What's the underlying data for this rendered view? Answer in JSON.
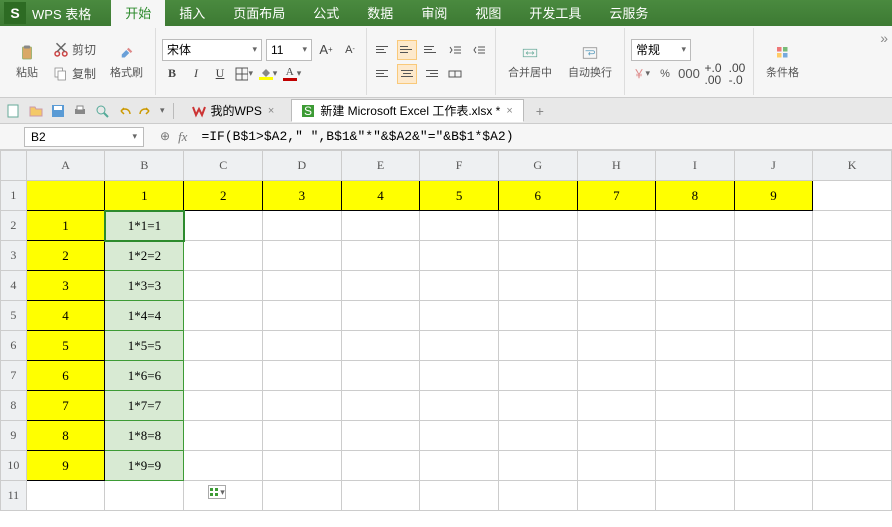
{
  "app": {
    "logo_letter": "S",
    "title": "WPS 表格"
  },
  "menu": {
    "tabs": [
      "开始",
      "插入",
      "页面布局",
      "公式",
      "数据",
      "审阅",
      "视图",
      "开发工具",
      "云服务"
    ],
    "active": 0
  },
  "ribbon": {
    "paste": "粘贴",
    "cut": "剪切",
    "copy": "复制",
    "format_painter": "格式刷",
    "font_name": "宋体",
    "font_size": "11",
    "merge_center": "合并居中",
    "wrap_text": "自动换行",
    "number_format": "常规",
    "cond_format": "条件格"
  },
  "qat": {
    "doc1": "我的WPS",
    "doc2": "新建 Microsoft Excel 工作表.xlsx *"
  },
  "formula_bar": {
    "cell_ref": "B2",
    "formula": "=IF(B$1>$A2,\" \",B$1&\"*\"&$A2&\"=\"&B$1*$A2)"
  },
  "sheet": {
    "col_headers": [
      "A",
      "B",
      "C",
      "D",
      "E",
      "F",
      "G",
      "H",
      "I",
      "J",
      "K"
    ],
    "row_headers": [
      "1",
      "2",
      "3",
      "4",
      "5",
      "6",
      "7",
      "8",
      "9",
      "10",
      "11"
    ],
    "row1": [
      "",
      "1",
      "2",
      "3",
      "4",
      "5",
      "6",
      "7",
      "8",
      "9"
    ],
    "colA": [
      "1",
      "2",
      "3",
      "4",
      "5",
      "6",
      "7",
      "8",
      "9"
    ],
    "colB": [
      "1*1=1",
      "1*2=2",
      "1*3=3",
      "1*4=4",
      "1*5=5",
      "1*6=6",
      "1*7=7",
      "1*8=8",
      "1*9=9"
    ]
  },
  "icons": {
    "scissors": "scissors",
    "brush": "brush",
    "clipboard": "clipboard"
  }
}
